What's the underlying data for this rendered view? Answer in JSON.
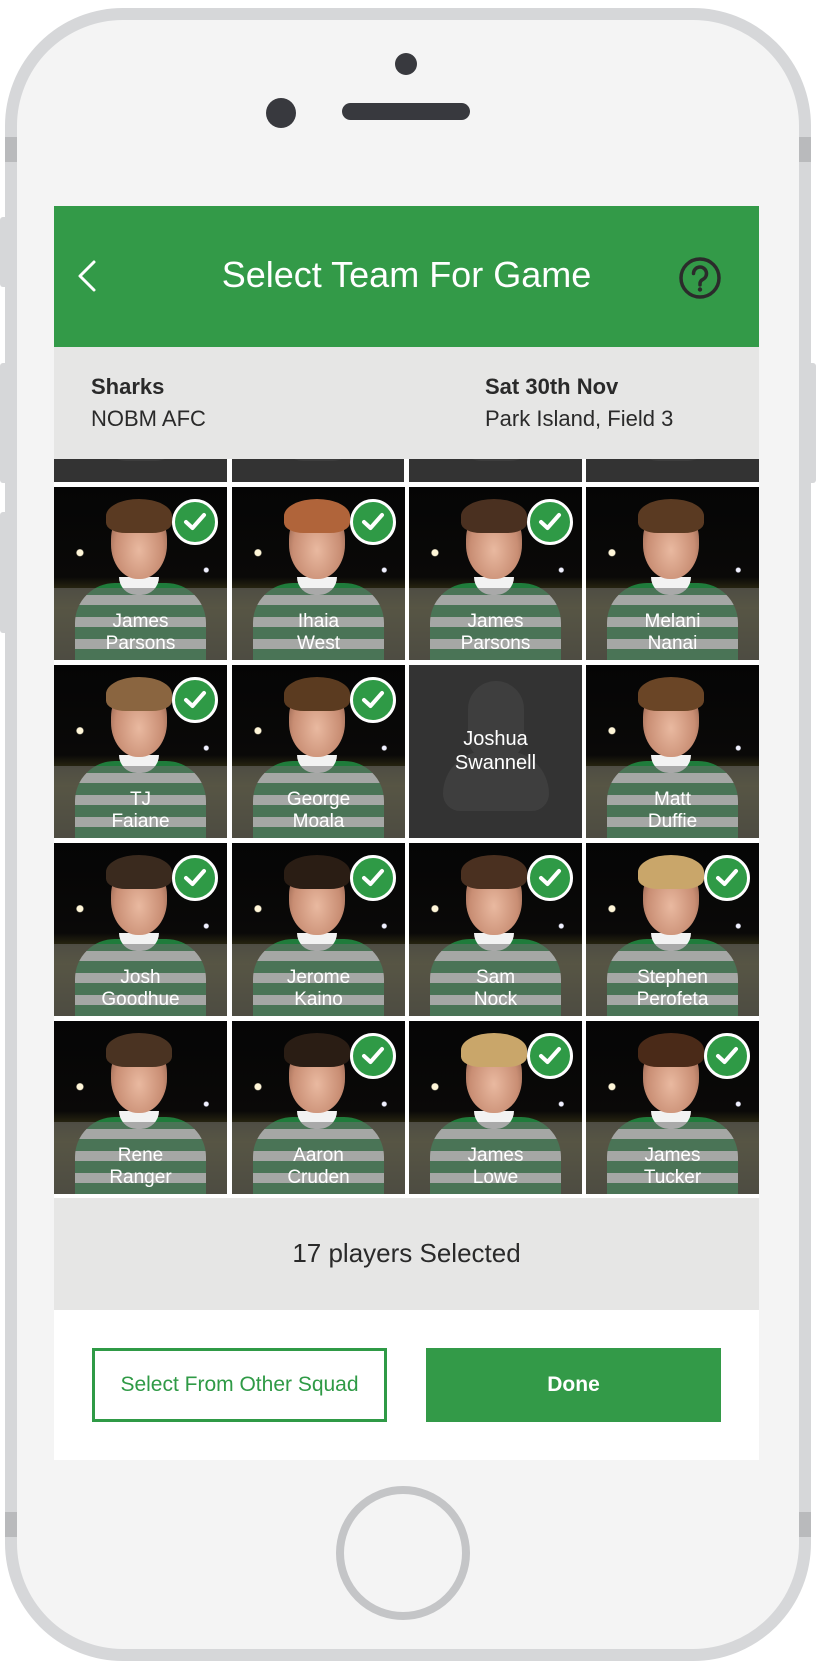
{
  "header": {
    "title": "Select Team For Game",
    "back_icon": "chevron-left-icon",
    "help_icon": "question-circle-icon"
  },
  "match": {
    "team_name": "Sharks",
    "club_name": "NOBM AFC",
    "date": "Sat 30th Nov",
    "venue": "Park Island, Field 3"
  },
  "players": [
    {
      "first": "James",
      "last": "Parsons",
      "selected": true,
      "photo": true
    },
    {
      "first": "Ihaia",
      "last": "West",
      "selected": true,
      "photo": true
    },
    {
      "first": "James",
      "last": "Parsons",
      "selected": true,
      "photo": true
    },
    {
      "first": "Melani",
      "last": "Nanai",
      "selected": false,
      "photo": true
    },
    {
      "first": "TJ",
      "last": "Faiane",
      "selected": true,
      "photo": true
    },
    {
      "first": "George",
      "last": "Moala",
      "selected": true,
      "photo": true
    },
    {
      "first": "Joshua",
      "last": "Swannell",
      "selected": false,
      "photo": false
    },
    {
      "first": "Matt",
      "last": "Duffie",
      "selected": false,
      "photo": true
    },
    {
      "first": "Josh",
      "last": "Goodhue",
      "selected": true,
      "photo": true
    },
    {
      "first": "Jerome",
      "last": "Kaino",
      "selected": true,
      "photo": true
    },
    {
      "first": "Sam",
      "last": "Nock",
      "selected": true,
      "photo": true
    },
    {
      "first": "Stephen",
      "last": "Perofeta",
      "selected": true,
      "photo": true
    },
    {
      "first": "Rene",
      "last": "Ranger",
      "selected": false,
      "photo": true
    },
    {
      "first": "Aaron",
      "last": "Cruden",
      "selected": true,
      "photo": true
    },
    {
      "first": "James",
      "last": "Lowe",
      "selected": true,
      "photo": true
    },
    {
      "first": "James",
      "last": "Tucker",
      "selected": true,
      "photo": true
    }
  ],
  "status": {
    "selected_text": "17 players Selected"
  },
  "actions": {
    "other_squad_label": "Select From Other Squad",
    "done_label": "Done"
  },
  "colors": {
    "brand_green": "#339a48",
    "check_green": "#2f9a46",
    "info_bar": "#e6e6e5"
  }
}
